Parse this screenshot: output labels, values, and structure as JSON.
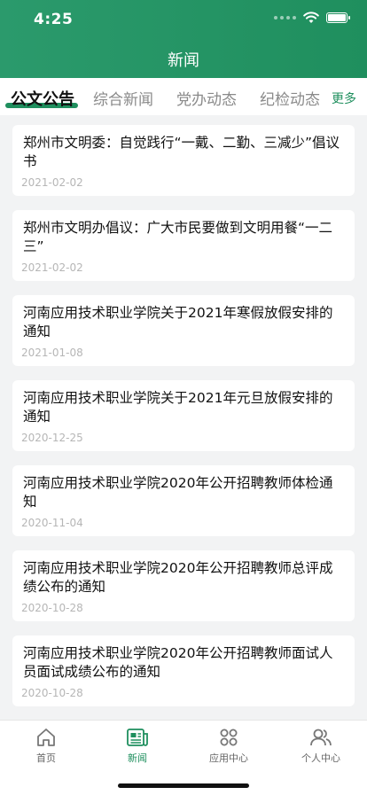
{
  "status_bar": {
    "time": "4:25"
  },
  "header": {
    "title": "新闻"
  },
  "tabs": {
    "items": [
      {
        "label": "公文公告",
        "active": true
      },
      {
        "label": "综合新闻",
        "active": false
      },
      {
        "label": "党办动态",
        "active": false
      },
      {
        "label": "纪检动态",
        "active": false
      }
    ],
    "more_label": "更多"
  },
  "news": [
    {
      "title": "郑州市文明委：自觉践行“一戴、二勤、三减少”倡议书",
      "date": "2021-02-02"
    },
    {
      "title": "郑州市文明办倡议：广大市民要做到文明用餐“一二三”",
      "date": "2021-02-02"
    },
    {
      "title": "河南应用技术职业学院关于2021年寒假放假安排的通知",
      "date": "2021-01-08"
    },
    {
      "title": "河南应用技术职业学院关于2021年元旦放假安排的通知",
      "date": "2020-12-25"
    },
    {
      "title": "河南应用技术职业学院2020年公开招聘教师体检通知",
      "date": "2020-11-04"
    },
    {
      "title": "河南应用技术职业学院2020年公开招聘教师总评成绩公布的通知",
      "date": "2020-10-28"
    },
    {
      "title": "河南应用技术职业学院2020年公开招聘教师面试人员面试成绩公布的通知",
      "date": "2020-10-28"
    }
  ],
  "tabbar": {
    "items": [
      {
        "label": "首页",
        "icon": "home-icon",
        "active": false
      },
      {
        "label": "新闻",
        "icon": "news-icon",
        "active": true
      },
      {
        "label": "应用中心",
        "icon": "apps-icon",
        "active": false
      },
      {
        "label": "个人中心",
        "icon": "profile-icon",
        "active": false
      }
    ]
  },
  "colors": {
    "brand_green": "#1f8f5e",
    "background": "#f2f3f4"
  }
}
